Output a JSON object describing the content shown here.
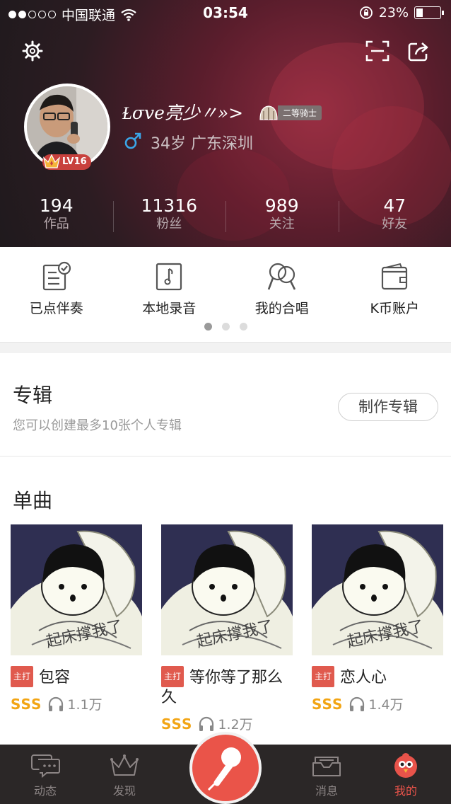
{
  "status_bar": {
    "carrier": "中国联通",
    "time": "03:54",
    "battery": "23%"
  },
  "profile": {
    "username": "Ɫσve亮少〃»>",
    "rank_badge": "二等骑士",
    "level": "LV16",
    "info": "34岁 广东深圳"
  },
  "stats": [
    {
      "value": "194",
      "label": "作品"
    },
    {
      "value": "11316",
      "label": "粉丝"
    },
    {
      "value": "989",
      "label": "关注"
    },
    {
      "value": "47",
      "label": "好友"
    }
  ],
  "quick_actions": [
    {
      "label": "已点伴奏",
      "icon": "accompaniment-list-icon"
    },
    {
      "label": "本地录音",
      "icon": "local-recording-icon"
    },
    {
      "label": "我的合唱",
      "icon": "chorus-icon"
    },
    {
      "label": "K币账户",
      "icon": "wallet-icon"
    }
  ],
  "pager": {
    "pages": 3,
    "active": 0
  },
  "album": {
    "title": "专辑",
    "subtitle": "您可以创建最多10张个人专辑",
    "create_button": "制作专辑"
  },
  "singles": {
    "title": "单曲",
    "items": [
      {
        "tag": "主打",
        "name": "包容",
        "grade": "SSS",
        "plays": "1.1万"
      },
      {
        "tag": "主打",
        "name": "等你等了那么久",
        "grade": "SSS",
        "plays": "1.2万"
      },
      {
        "tag": "主打",
        "name": "恋人心",
        "grade": "SSS",
        "plays": "1.4万"
      }
    ]
  },
  "tabbar": {
    "items": [
      {
        "label": "动态",
        "icon": "chat-icon"
      },
      {
        "label": "发现",
        "icon": "crown-icon"
      },
      {
        "label": "消息",
        "icon": "inbox-icon"
      },
      {
        "label": "我的",
        "icon": "profile-bird-icon"
      }
    ],
    "active": "我的"
  },
  "colors": {
    "accent": "#e8534a",
    "grade": "#f2a515",
    "tabbar_bg": "#2b2727"
  }
}
